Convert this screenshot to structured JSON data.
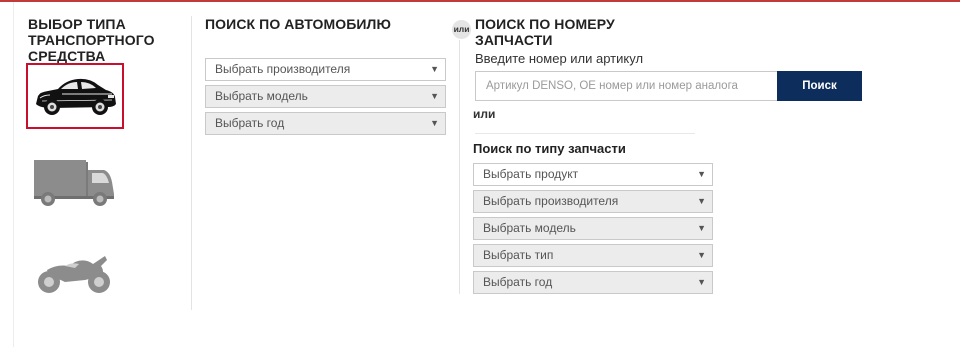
{
  "vehicle_type": {
    "heading": "ВЫБОР ТИПА ТРАНСПОРТНОГО СРЕДСТВА",
    "tiles": [
      {
        "icon": "car-icon",
        "selected": true
      },
      {
        "icon": "truck-icon",
        "selected": false
      },
      {
        "icon": "motorcycle-icon",
        "selected": false
      }
    ]
  },
  "car_search": {
    "heading": "ПОИСК ПО АВТОМОБИЛЮ",
    "selects": [
      {
        "label": "Выбрать производителя",
        "disabled": false
      },
      {
        "label": "Выбрать модель",
        "disabled": true
      },
      {
        "label": "Выбрать год",
        "disabled": true
      }
    ]
  },
  "or_badge": "или",
  "part_number_search": {
    "heading": "ПОИСК ПО НОМЕРУ ЗАПЧАСТИ",
    "subtext": "Введите номер или артикул",
    "input_placeholder": "Артикул DENSO, OE номер или номер аналога",
    "button_label": "Поиск",
    "or_text": "или"
  },
  "part_type_search": {
    "heading": "Поиск по типу запчасти",
    "selects": [
      {
        "label": "Выбрать продукт",
        "disabled": false
      },
      {
        "label": "Выбрать производителя",
        "disabled": true
      },
      {
        "label": "Выбрать модель",
        "disabled": true
      },
      {
        "label": "Выбрать тип",
        "disabled": true
      },
      {
        "label": "Выбрать год",
        "disabled": true
      }
    ]
  },
  "colors": {
    "accent_red": "#c8102e",
    "button_blue": "#0d2e5c"
  }
}
